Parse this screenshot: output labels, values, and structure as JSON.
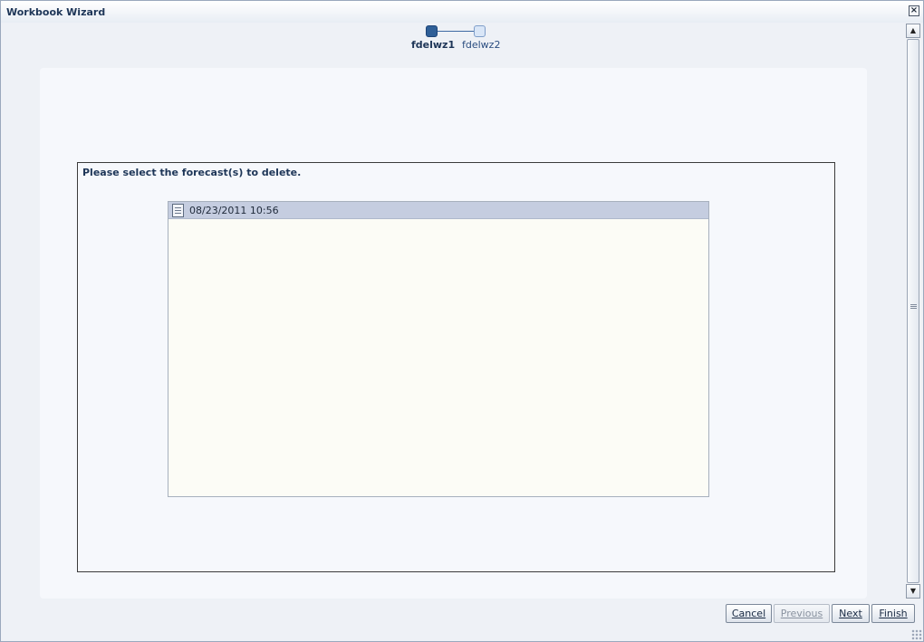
{
  "window": {
    "title": "Workbook Wizard",
    "close_label": "×"
  },
  "train": {
    "steps": [
      {
        "label": "fdelwz1",
        "state": "current"
      },
      {
        "label": "fdelwz2",
        "state": "pending"
      }
    ]
  },
  "content": {
    "instruction": "Please select the forecast(s) to delete.",
    "forecasts": [
      {
        "label": "08/23/2011 10:56",
        "selected": true,
        "icon": "document-icon"
      }
    ]
  },
  "buttons": {
    "cancel": "Cancel",
    "previous": "Previous",
    "next": "Next",
    "finish": "Finish"
  },
  "scrollbar": {
    "up_glyph": "▲",
    "down_glyph": "▼"
  },
  "colors": {
    "accent": "#2f5f97",
    "selection": "#c5cde0",
    "panel": "#f6f8fc"
  }
}
